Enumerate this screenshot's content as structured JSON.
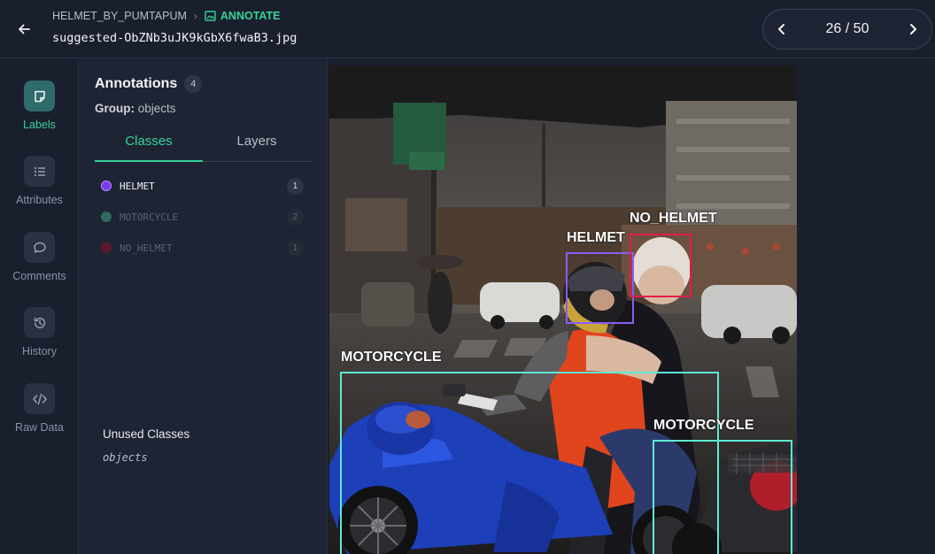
{
  "header": {
    "project": "HELMET_BY_PUMTAPUM",
    "mode": "ANNOTATE",
    "filename": "suggested-ObZNb3uJK9kGbX6fwaB3.jpg",
    "pager": "26 / 50"
  },
  "rail": [
    {
      "label": "Labels",
      "icon": "tag-icon",
      "active": true
    },
    {
      "label": "Attributes",
      "icon": "list-icon",
      "active": false
    },
    {
      "label": "Comments",
      "icon": "comment-icon",
      "active": false
    },
    {
      "label": "History",
      "icon": "history-icon",
      "active": false
    },
    {
      "label": "Raw Data",
      "icon": "code-icon",
      "active": false
    }
  ],
  "panel": {
    "title": "Annotations",
    "count": "4",
    "group_label": "Group:",
    "group_value": "objects",
    "tabs": [
      "Classes",
      "Layers"
    ],
    "active_tab": "Classes",
    "classes": [
      {
        "name": "HELMET",
        "count": "1",
        "color": "#7c3aed",
        "active": true
      },
      {
        "name": "MOTORCYCLE",
        "count": "2",
        "color": "#2f6b5e",
        "active": false
      },
      {
        "name": "NO_HELMET",
        "count": "1",
        "color": "#5a1a2e",
        "active": false
      }
    ],
    "unused_title": "Unused Classes",
    "unused_items": [
      "objects"
    ]
  },
  "annotations": [
    {
      "label": "HELMET",
      "color": "#8b5cf6"
    },
    {
      "label": "NO_HELMET",
      "color": "#e11d48"
    },
    {
      "label": "MOTORCYCLE",
      "color": "#5eead4"
    },
    {
      "label": "MOTORCYCLE",
      "color": "#5eead4"
    }
  ],
  "colors": {
    "accent": "#34d399",
    "background": "#1a1f2e",
    "panel": "#1e2433"
  }
}
